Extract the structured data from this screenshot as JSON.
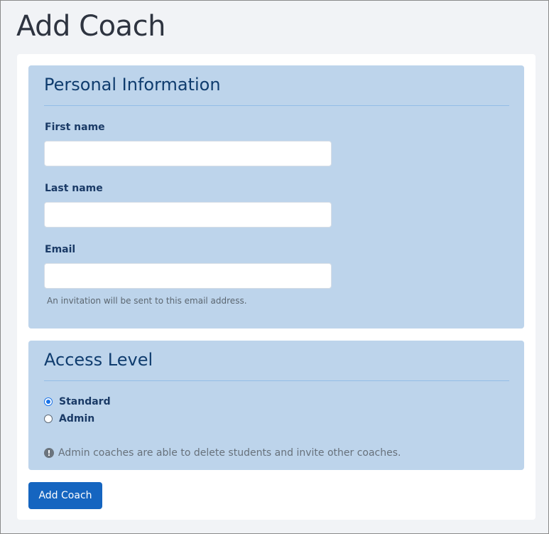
{
  "page": {
    "title": "Add Coach"
  },
  "personal_info": {
    "heading": "Personal Information",
    "first_name": {
      "label": "First name",
      "value": ""
    },
    "last_name": {
      "label": "Last name",
      "value": ""
    },
    "email": {
      "label": "Email",
      "value": "",
      "help": "An invitation will be sent to this email address."
    }
  },
  "access_level": {
    "heading": "Access Level",
    "options": [
      {
        "label": "Standard",
        "selected": true
      },
      {
        "label": "Admin",
        "selected": false
      }
    ],
    "info_icon": "exclamation-circle-icon",
    "info_text": "Admin coaches are able to delete students and invite other coaches."
  },
  "actions": {
    "submit_label": "Add Coach"
  },
  "colors": {
    "page_background": "#f1f3f6",
    "section_background": "#bdd4eb",
    "heading_text": "#0f3c6e",
    "primary_button": "#1565c0",
    "radio_selected": "#1a73e8"
  }
}
